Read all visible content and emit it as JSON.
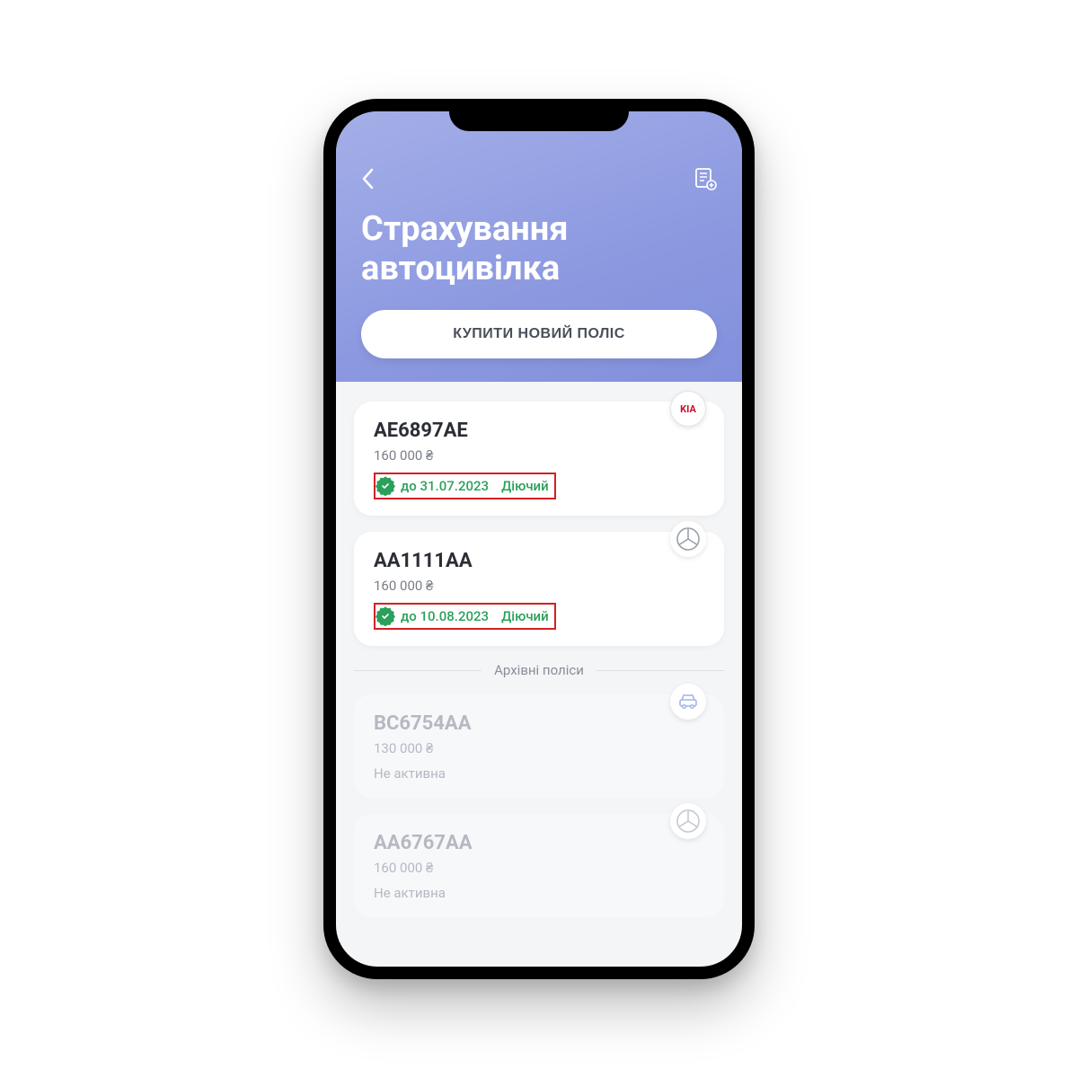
{
  "header": {
    "title_line1": "Страхування",
    "title_line2": "автоцивілка",
    "buy_button": "КУПИТИ НОВИЙ ПОЛІС"
  },
  "active_policies": [
    {
      "plate": "AE6897AE",
      "amount": "160 000 ₴",
      "date_until": "до 31.07.2023",
      "status": "Діючий",
      "brand": "KIA",
      "brand_type": "kia",
      "highlighted": true
    },
    {
      "plate": "AA1111AA",
      "amount": "160 000 ₴",
      "date_until": "до 10.08.2023",
      "status": "Діючий",
      "brand": "merc",
      "brand_type": "merc",
      "highlighted": true
    }
  ],
  "archive_section_label": "Архівні поліси",
  "archived_policies": [
    {
      "plate": "BC6754AA",
      "amount": "130 000 ₴",
      "status": "Не активна",
      "brand_type": "car"
    },
    {
      "plate": "AA6767AA",
      "amount": "160 000 ₴",
      "status": "Не активна",
      "brand_type": "merc"
    }
  ],
  "colors": {
    "accent_green": "#2aa15a",
    "highlight_red": "#d42024",
    "header_purple": "#8c99e0"
  }
}
